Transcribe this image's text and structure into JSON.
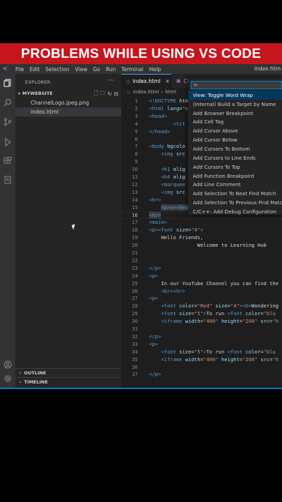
{
  "banner": {
    "text": "PROBLEMS WHILE USING VS CODE"
  },
  "menubar": {
    "items": [
      "File",
      "Edit",
      "Selection",
      "View",
      "Go",
      "Run",
      "Terminal",
      "Help"
    ],
    "window_title": "index.htm"
  },
  "activity_icons": [
    "explorer-icon",
    "search-icon",
    "source-control-icon",
    "run-debug-icon",
    "extensions-icon",
    "remote-icon",
    "account-icon",
    "gear-icon"
  ],
  "sidebar": {
    "title": "EXPLORER",
    "folder": "MYWEBSITE",
    "files": [
      "ChannelLogo.jpeg.png",
      "index.html"
    ],
    "outline": "OUTLINE",
    "timeline": "TIMELINE"
  },
  "editor": {
    "tabs": [
      {
        "label": "index.html",
        "close": "×"
      },
      {
        "label": "Cl"
      }
    ],
    "breadcrumb": {
      "file": "index.html",
      "sep": "›",
      "node": "html"
    }
  },
  "palette": {
    "input": ">",
    "items": [
      "View: Toggle Word Wrap",
      "(Internal) Build a Target by Name",
      "Add Browser Breakpoint",
      "Add Cell Tag",
      "Add Cursor Above",
      "Add Cursor Below",
      "Add Cursors To Bottom",
      "Add Cursors to Line Ends",
      "Add Cursors To Top",
      "Add Function Breakpoint",
      "Add Line Comment",
      "Add Selection To Next Find Match",
      "Add Selection To Previous Find Match",
      "C/C++: Add Debug Configuration"
    ]
  },
  "code_lines": [
    {
      "n": "1",
      "h": "<span class=\"tag\">&lt;!DOCTYPE</span> <span class=\"attr\">htm</span>"
    },
    {
      "n": "2",
      "h": "<span class=\"tag\">&lt;html</span> <span class=\"attr\">lang</span>=<span class=\"str\">\"e</span>"
    },
    {
      "n": "3",
      "h": "<span class=\"tag\">&lt;head&gt;</span>"
    },
    {
      "n": "4",
      "h": "        <span class=\"tag\">&lt;tit</span>"
    },
    {
      "n": "5",
      "h": "<span class=\"tag\">&lt;/head&gt;</span>"
    },
    {
      "n": "6",
      "h": ""
    },
    {
      "n": "7",
      "h": "<span class=\"tag\">&lt;body</span> <span class=\"attr\">bgcolo</span>"
    },
    {
      "n": "8",
      "h": "    <span class=\"tag\">&lt;img</span> <span class=\"attr\">src</span>"
    },
    {
      "n": "9",
      "h": ""
    },
    {
      "n": "10",
      "h": "    <span class=\"tag\">&lt;h1</span> <span class=\"attr\">alig</span>"
    },
    {
      "n": "11",
      "h": "    <span class=\"tag\">&lt;h4</span> <span class=\"attr\">alig</span>"
    },
    {
      "n": "12",
      "h": "    <span class=\"tag\">&lt;marquee</span>"
    },
    {
      "n": "13",
      "h": "    <span class=\"tag\">&lt;img</span> <span class=\"attr\">src</span>"
    },
    {
      "n": "14",
      "h": "<span class=\"tag\">&lt;hr&gt;</span>"
    },
    {
      "n": "15",
      "h": "    <span class=\"hl\"><span class=\"tag\">&lt;pre&gt;&lt;hea</span></span>"
    },
    {
      "n": "16",
      "h": "<span class=\"hl\"><span class=\"tag\">&lt;hr&gt;</span></span>"
    },
    {
      "n": "17",
      "h": "<span class=\"tag\">&lt;main&gt;</span>"
    },
    {
      "n": "18",
      "h": "<span class=\"tag\">&lt;p&gt;&lt;font</span> <span class=\"attr\">size</span>=<span class=\"str\">\"4\"</span><span class=\"tag\">&gt;</span>"
    },
    {
      "n": "19",
      "h": "    <span class=\"txt\">Hello Friends,</span>"
    },
    {
      "n": "20",
      "h": "                <span class=\"txt\">Welcome to Learning Hub</span>"
    },
    {
      "n": "21",
      "h": ""
    },
    {
      "n": "22",
      "h": ""
    },
    {
      "n": "23",
      "h": "<span class=\"tag\">&lt;/p&gt;</span>"
    },
    {
      "n": "24",
      "h": "<span class=\"tag\">&lt;p&gt;</span>"
    },
    {
      "n": "25",
      "h": "    <span class=\"txt\">In our YouTube Channel you can find the</span>"
    },
    {
      "n": "26",
      "h": "    <span class=\"tag\">&lt;br&gt;&lt;hr&gt;</span>"
    },
    {
      "n": "27",
      "h": "<span class=\"tag\">&lt;p&gt;</span>"
    },
    {
      "n": "28",
      "h": "    <span class=\"tag\">&lt;font</span> <span class=\"attr\">color</span>=<span class=\"str\">\"Red\"</span> <span class=\"attr\">size</span>=<span class=\"str\">\"4\"</span><span class=\"tag\">&gt;&lt;b&gt;</span><span class=\"txt\">Wondering</span>"
    },
    {
      "n": "29",
      "h": "    <span class=\"tag\">&lt;font</span> <span class=\"attr\">size</span>=<span class=\"str\">\"5\"</span><span class=\"tag\">&gt;</span><span class=\"txt\">To run </span><span class=\"tag\">&lt;font</span> <span class=\"attr\">color</span>=<span class=\"str\">\"blu</span>"
    },
    {
      "n": "30",
      "h": "    <span class=\"tag\">&lt;iframe</span> <span class=\"attr\">width</span>=<span class=\"str\">\"400\"</span> <span class=\"attr\">height</span>=<span class=\"str\">\"200\"</span> <span class=\"attr\">src</span>=<span class=\"str\">\"h</span>"
    },
    {
      "n": "31",
      "h": ""
    },
    {
      "n": "32",
      "h": "<span class=\"tag\">&lt;/p&gt;</span>"
    },
    {
      "n": "33",
      "h": "<span class=\"tag\">&lt;p&gt;</span>"
    },
    {
      "n": "34",
      "h": "    <span class=\"tag\">&lt;font</span> <span class=\"attr\">size</span>=<span class=\"str\">\"5\"</span><span class=\"tag\">&gt;</span><span class=\"txt\">To run </span><span class=\"tag\">&lt;font</span> <span class=\"attr\">color</span>=<span class=\"str\">\"blu</span>"
    },
    {
      "n": "35",
      "h": "    <span class=\"tag\">&lt;iframe</span> <span class=\"attr\">width</span>=<span class=\"str\">\"400\"</span> <span class=\"attr\">height</span>=<span class=\"str\">\"200\"</span> <span class=\"attr\">src</span>=<span class=\"str\">\"h</span>"
    },
    {
      "n": "36",
      "h": ""
    },
    {
      "n": "37",
      "h": "<span class=\"tag\">&lt;/p&gt;</span>"
    }
  ],
  "current_line": "16",
  "colors": {
    "banner": "#c4161c",
    "accent": "#007acc"
  }
}
